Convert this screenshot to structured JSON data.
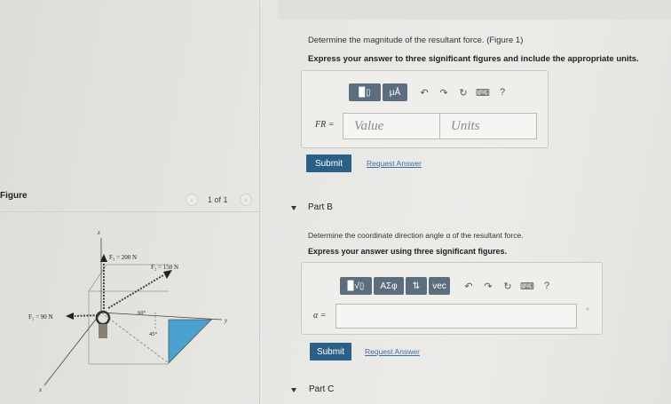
{
  "partA": {
    "question": "Determine the magnitude of the resultant force. (Figure 1)",
    "instruction": "Express your answer to three significant figures and include the appropriate units.",
    "toolbar": {
      "units_btn": "μÅ",
      "help": "?"
    },
    "label": "FR =",
    "value_placeholder": "Value",
    "units_placeholder": "Units",
    "submit": "Submit",
    "request": "Request Answer"
  },
  "figurePanel": {
    "title": "Figure",
    "pager": "1 of 1"
  },
  "figure": {
    "z": "z",
    "y": "y",
    "x": "x",
    "f3": "F₃ = 200 N",
    "f2": "F₂ = 150 N",
    "f1": "F₁ = 90 N",
    "angle60": "60°",
    "angle45": "45°"
  },
  "partB": {
    "title": "Part B",
    "question": "Determine the coordinate direction angle α of the resultant force.",
    "instruction": "Express your answer using three significant figures.",
    "toolbar": {
      "sym": "ΑΣφ",
      "vec": "vec",
      "help": "?"
    },
    "label": "α =",
    "unit": "°",
    "submit": "Submit",
    "request": "Request Answer"
  },
  "partC": {
    "title": "Part C"
  },
  "colors": {
    "accent": "#2a5f87",
    "toolbar": "#5c6e7d",
    "link": "#3b6ea3",
    "blue_fill": "#4aa3cf"
  }
}
